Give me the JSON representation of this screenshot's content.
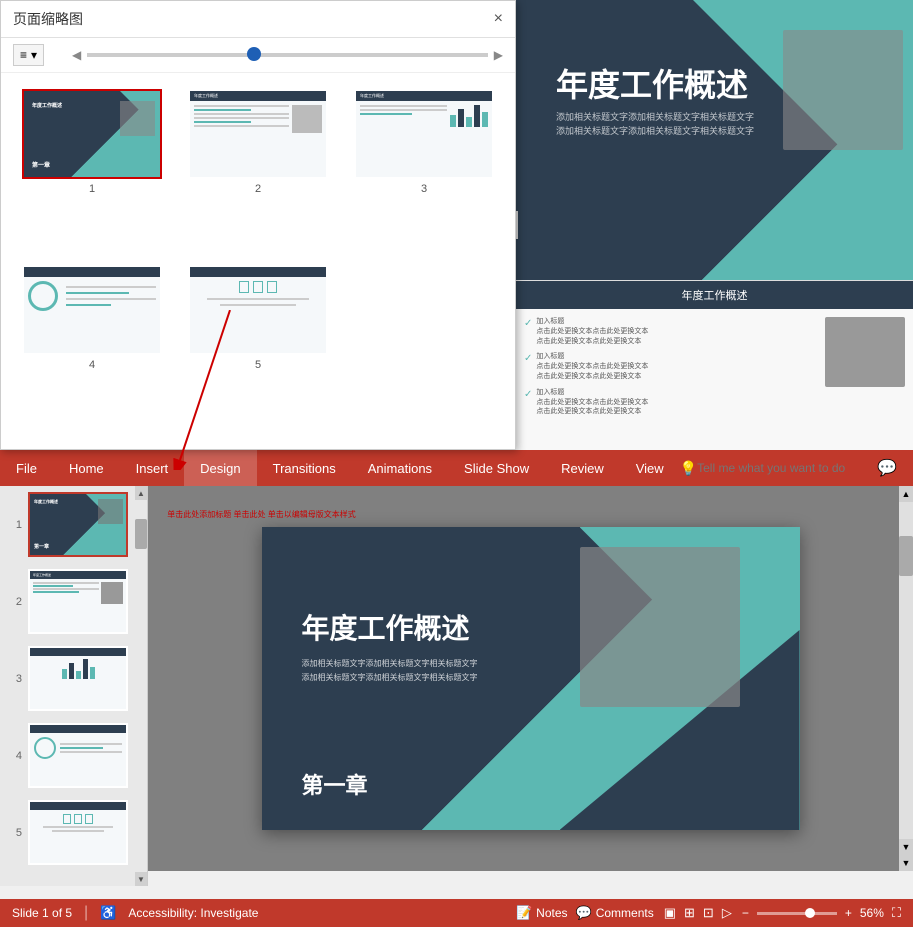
{
  "panel": {
    "title": "页面缩略图",
    "close_label": "×",
    "toolbar_btn": "≡",
    "slides": [
      {
        "num": "1",
        "active": true
      },
      {
        "num": "2",
        "active": false
      },
      {
        "num": "3",
        "active": false
      },
      {
        "num": "4",
        "active": false
      },
      {
        "num": "5",
        "active": false
      }
    ]
  },
  "slide_preview": {
    "title": "年度工作概述",
    "subtitle_lines": [
      "添加相关标题文字添加相关标题文字相关标题文字",
      "添加相关标题文字添加相关标题文字相关标题文字"
    ],
    "chapter": "第一章",
    "section_title": "年度工作概述",
    "check_items": [
      {
        "label": "加入标题",
        "detail": "点击此处更换文本点击此处更换此处更换文本\n点击此处更换文本点此处更换文本"
      },
      {
        "label": "加入标题",
        "detail": "点击此处更换文本点击此处更换此处更换文本\n点击此处更换文本点此处更换文本"
      },
      {
        "label": "加入标题",
        "detail": "点击此处更换文本点击此处更换此处更换文本\n点击此处更换文本点此处更换文本"
      }
    ]
  },
  "ribbon": {
    "tabs": [
      "File",
      "Home",
      "Insert",
      "Design",
      "Transitions",
      "Animations",
      "Slide Show",
      "Review",
      "View"
    ],
    "active_tab": "Design",
    "search_placeholder": "Tell me what you want to do",
    "lightbulb_icon": "💡",
    "comment_icon": "💬"
  },
  "left_panel": {
    "slides": [
      {
        "num": "1",
        "selected": true
      },
      {
        "num": "2",
        "selected": false
      },
      {
        "num": "3",
        "selected": false
      },
      {
        "num": "4",
        "selected": false
      },
      {
        "num": "5",
        "selected": false
      }
    ]
  },
  "main_edit": {
    "edit_notice": "单击此处添加标题  单击此处  单击以编辑母版文本样式",
    "title": "年度工作概述",
    "subtitle": "添加相关标题文字添加相关标题文字相关标题文字\n添加相关标题文字添加相关标题文字相关标题文字",
    "chapter": "第一章"
  },
  "status_bar": {
    "slide_info": "Slide 1 of 5",
    "accessibility": "Accessibility: Investigate",
    "notes_label": "Notes",
    "comments_label": "Comments",
    "zoom_percent": "56%"
  }
}
